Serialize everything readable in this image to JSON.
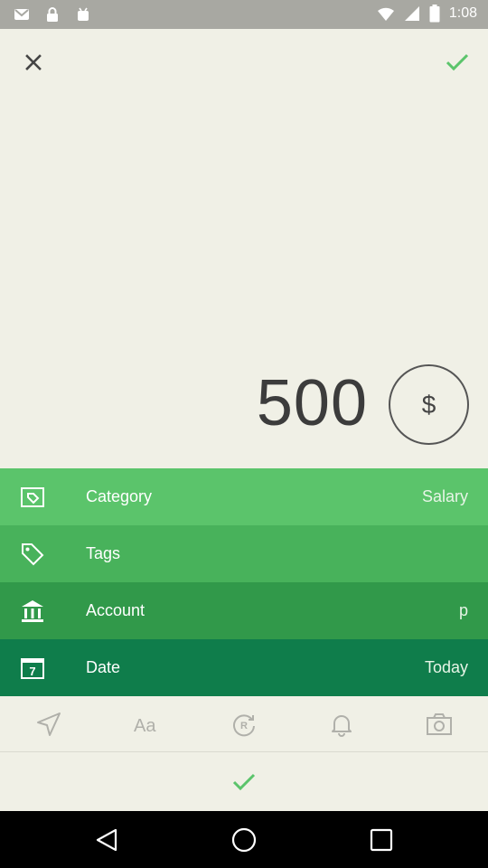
{
  "status_bar": {
    "time": "1:08",
    "icons": [
      "gmail-icon",
      "lock-icon",
      "android-icon",
      "wifi-icon",
      "signal-icon",
      "battery-icon"
    ]
  },
  "header": {
    "close_icon": "close-icon",
    "confirm_icon": "check-icon"
  },
  "amount": {
    "value": "500",
    "currency_symbol": "$"
  },
  "rows": [
    {
      "label": "Category",
      "value": "Salary",
      "icon": "category-icon"
    },
    {
      "label": "Tags",
      "value": "",
      "icon": "tag-icon"
    },
    {
      "label": "Account",
      "value": "p",
      "icon": "bank-icon"
    },
    {
      "label": "Date",
      "value": "Today",
      "icon": "calendar-icon",
      "icon_text": "7"
    }
  ],
  "toolbar": {
    "items": [
      "location-icon",
      "text-format-icon",
      "recurring-icon",
      "reminder-icon",
      "camera-icon"
    ],
    "icon_color": "#b0b0aa"
  },
  "colors": {
    "accent_check": "#5bc46b",
    "background": "#f0f0e6",
    "row_1": "#5bc46b",
    "row_2": "#48b25b",
    "row_3": "#31994a",
    "row_4": "#0f7d4b"
  }
}
